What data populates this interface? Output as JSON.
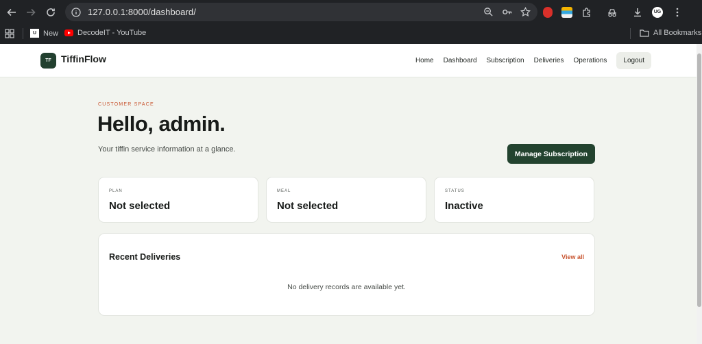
{
  "browser": {
    "url": "127.0.0.1:8000/dashboard/",
    "bookmarks": [
      {
        "label": "New",
        "icon": "uo-logo-icon"
      },
      {
        "label": "DecodeIT - YouTube",
        "icon": "youtube-icon"
      }
    ],
    "all_bookmarks": "All Bookmarks",
    "profile_initials": "UG"
  },
  "header": {
    "logo_text": "TF",
    "brand": "TiffinFlow",
    "nav": [
      "Home",
      "Dashboard",
      "Subscription",
      "Deliveries",
      "Operations"
    ],
    "logout": "Logout"
  },
  "hero": {
    "eyebrow": "CUSTOMER SPACE",
    "greeting": "Hello, admin.",
    "subtitle": "Your tiffin service information at a glance.",
    "manage_button": "Manage Subscription"
  },
  "cards": [
    {
      "label": "PLAN",
      "value": "Not selected"
    },
    {
      "label": "MEAL",
      "value": "Not selected"
    },
    {
      "label": "STATUS",
      "value": "Inactive"
    }
  ],
  "deliveries": {
    "title": "Recent Deliveries",
    "view_all": "View all",
    "empty_message": "No delivery records are available yet."
  },
  "colors": {
    "accent": "#c8542f",
    "brand_green": "#23432f",
    "background": "#f2f4ef"
  }
}
